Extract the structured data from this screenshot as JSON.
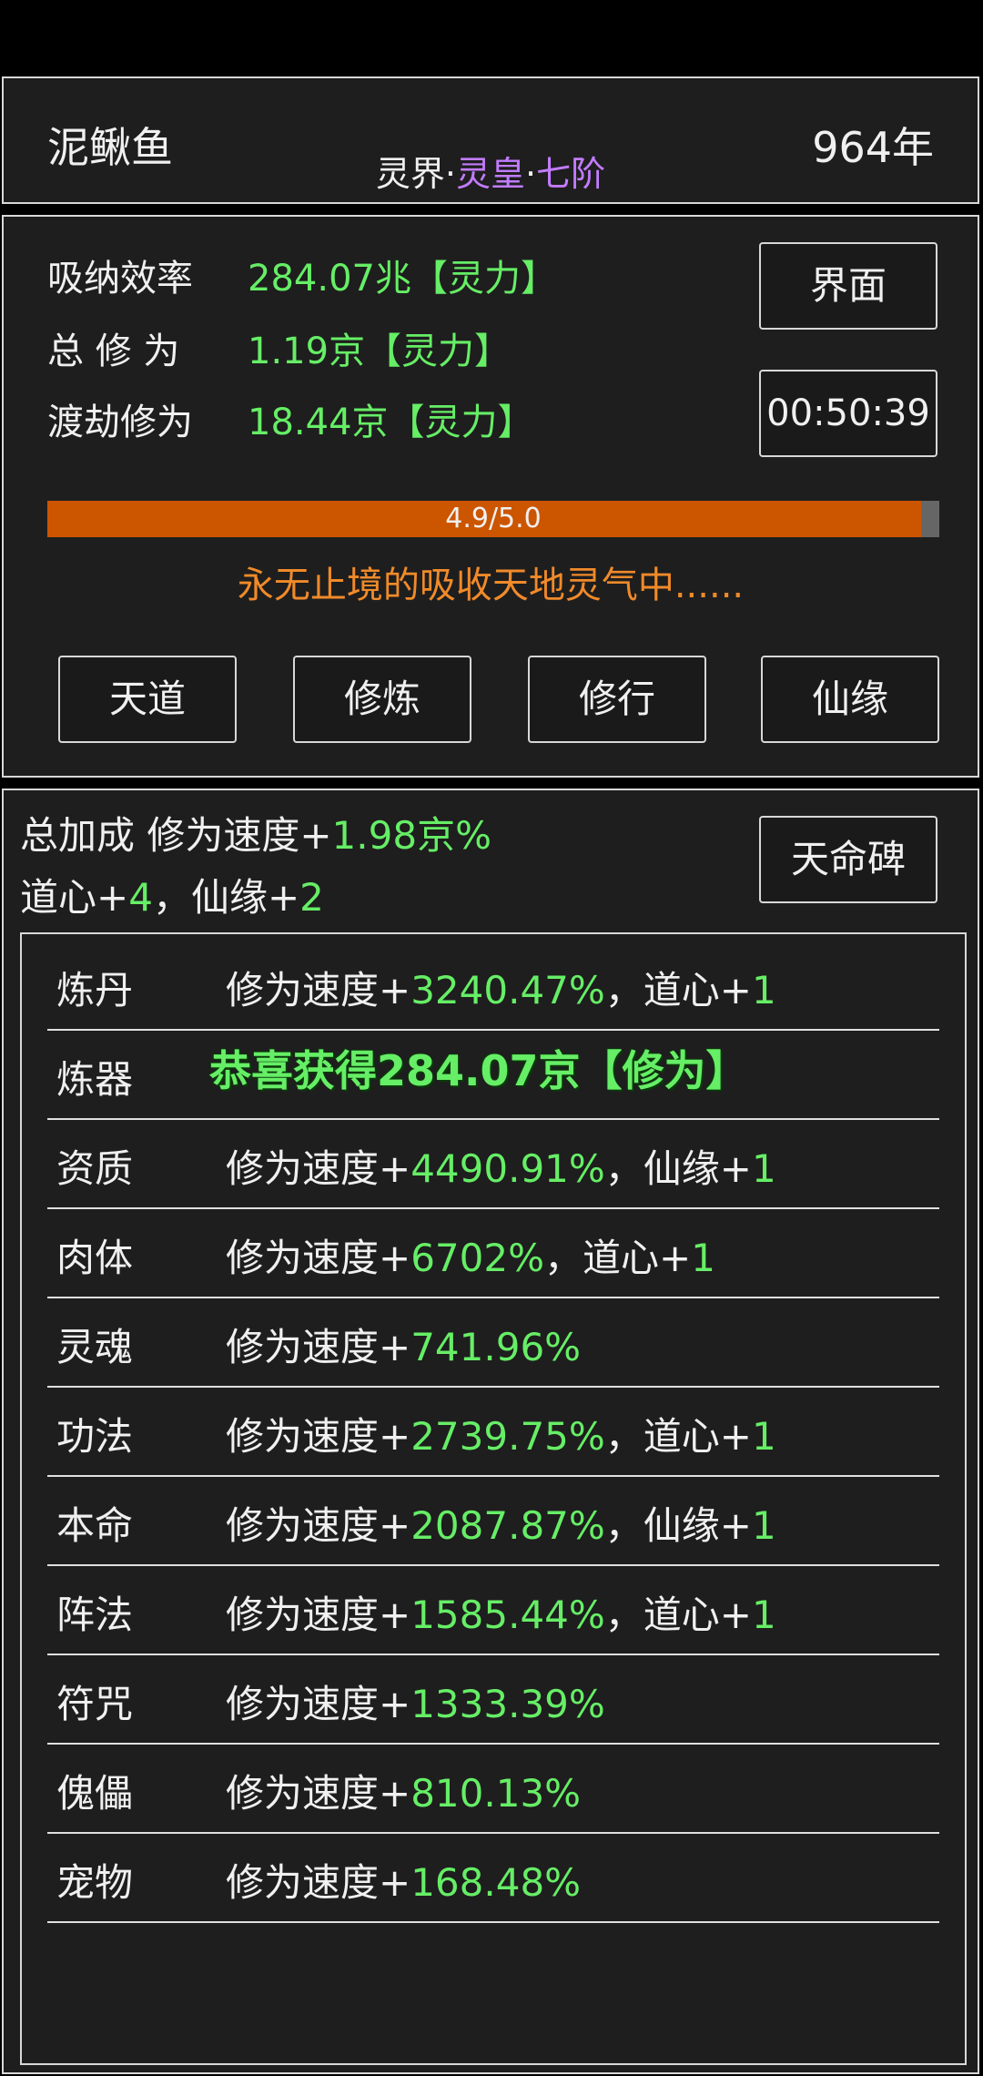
{
  "header": {
    "name": "泥鳅鱼",
    "year": "964年",
    "realm_prefix": "灵界·",
    "realm_rank": "灵皇",
    "realm_sep": "·",
    "realm_stage": "七阶"
  },
  "status": {
    "rows": [
      {
        "label": "吸纳效率",
        "value": "284.07兆【灵力】"
      },
      {
        "label": "总 修 为",
        "value": "1.19京【灵力】"
      },
      {
        "label": "渡劫修为",
        "value": "18.44京【灵力】"
      }
    ],
    "interface_button": "界面",
    "timer": "00:50:39",
    "progress": {
      "text": "4.9/5.0",
      "fraction": 0.98
    },
    "message": "永无止境的吸收天地灵气中......",
    "tabs": [
      "天道",
      "修炼",
      "修行",
      "仙缘"
    ]
  },
  "bonus": {
    "line1_label": "总加成 修为速度+",
    "line1_value": "1.98京%",
    "line2_a": "道心+",
    "line2_a_val": "4",
    "line2_sep": "，仙缘+",
    "line2_b_val": "2",
    "stele_button": "天命碑",
    "rows": [
      {
        "cat": "炼丹",
        "prefix": "修为速度+",
        "pct": "3240.47%",
        "extra": "，道心+",
        "extra_val": "1"
      },
      {
        "cat": "炼器",
        "prefix": "",
        "pct": "",
        "extra": "",
        "extra_val": ""
      },
      {
        "cat": "资质",
        "prefix": "修为速度+",
        "pct": "4490.91%",
        "extra": "，仙缘+",
        "extra_val": "1"
      },
      {
        "cat": "肉体",
        "prefix": "修为速度+",
        "pct": "6702%",
        "extra": "，道心+",
        "extra_val": "1"
      },
      {
        "cat": "灵魂",
        "prefix": "修为速度+",
        "pct": "741.96%",
        "extra": "",
        "extra_val": ""
      },
      {
        "cat": "功法",
        "prefix": "修为速度+",
        "pct": "2739.75%",
        "extra": "，道心+",
        "extra_val": "1"
      },
      {
        "cat": "本命",
        "prefix": "修为速度+",
        "pct": "2087.87%",
        "extra": "，仙缘+",
        "extra_val": "1"
      },
      {
        "cat": "阵法",
        "prefix": "修为速度+",
        "pct": "1585.44%",
        "extra": "，道心+",
        "extra_val": "1"
      },
      {
        "cat": "符咒",
        "prefix": "修为速度+",
        "pct": "1333.39%",
        "extra": "",
        "extra_val": ""
      },
      {
        "cat": "傀儡",
        "prefix": "修为速度+",
        "pct": "810.13%",
        "extra": "",
        "extra_val": ""
      },
      {
        "cat": "宠物",
        "prefix": "修为速度+",
        "pct": "168.48%",
        "extra": "",
        "extra_val": ""
      }
    ]
  },
  "toast": "恭喜获得284.07京【修为】",
  "colors": {
    "accent_green": "#66ee66",
    "realm_purple": "#c27cff",
    "progress_orange": "#cc5500",
    "message_orange": "#f08a2a"
  }
}
